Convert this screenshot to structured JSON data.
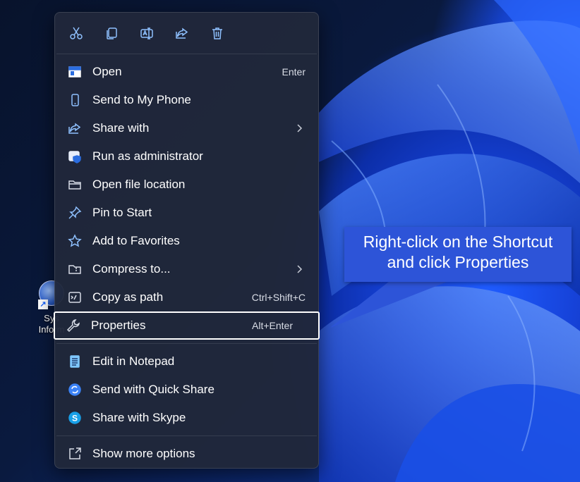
{
  "desktop": {
    "shortcut_label_line1": "Sys",
    "shortcut_label_line2": "Inform"
  },
  "toolbar": {
    "icons": [
      "cut-icon",
      "copy-icon",
      "rename-icon",
      "share-icon",
      "delete-icon"
    ]
  },
  "menu": {
    "items": [
      {
        "label": "Open",
        "shortcut": "Enter",
        "icon": "open-window-icon"
      },
      {
        "label": "Send to My Phone",
        "shortcut": "",
        "icon": "phone-icon"
      },
      {
        "label": "Share with",
        "shortcut": "",
        "icon": "share-icon",
        "submenu": true
      },
      {
        "label": "Run as administrator",
        "shortcut": "",
        "icon": "shield-window-icon"
      },
      {
        "label": "Open file location",
        "shortcut": "",
        "icon": "folder-icon"
      },
      {
        "label": "Pin to Start",
        "shortcut": "",
        "icon": "pin-icon"
      },
      {
        "label": "Add to Favorites",
        "shortcut": "",
        "icon": "star-icon"
      },
      {
        "label": "Compress to...",
        "shortcut": "",
        "icon": "zip-folder-icon",
        "submenu": true
      },
      {
        "label": "Copy as path",
        "shortcut": "Ctrl+Shift+C",
        "icon": "path-icon"
      },
      {
        "label": "Properties",
        "shortcut": "Alt+Enter",
        "icon": "wrench-icon"
      },
      {
        "label": "Edit in Notepad",
        "shortcut": "",
        "icon": "notepad-icon"
      },
      {
        "label": "Send with Quick Share",
        "shortcut": "",
        "icon": "quick-share-icon"
      },
      {
        "label": "Share with Skype",
        "shortcut": "",
        "icon": "skype-icon"
      },
      {
        "label": "Show more options",
        "shortcut": "",
        "icon": "more-options-icon"
      }
    ]
  },
  "callout": {
    "line1": "Right-click on the Shortcut",
    "line2": "and click Properties"
  },
  "colors": {
    "accent": "#8fc1ff",
    "menu_bg": "#20283a",
    "callout_bg": "#2d54d8"
  }
}
